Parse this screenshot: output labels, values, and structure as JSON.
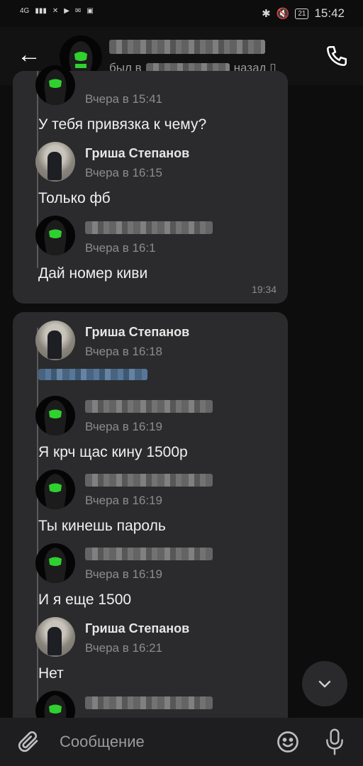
{
  "status_bar": {
    "network": "4G",
    "time": "15:42",
    "battery": "21"
  },
  "header": {
    "status_prefix": "был в",
    "status_suffix": "назад"
  },
  "messages": [
    {
      "time": "Вчера в 15:41",
      "text": "У тебя привязка к чему?"
    },
    {
      "sender": "Гриша Степанов",
      "time": "Вчера в 16:15",
      "text": "Только фб"
    },
    {
      "time": "Вчера в 16:1",
      "text": "Дай номер киви"
    },
    {
      "bubble_time": "19:34"
    },
    {
      "sender": "Гриша Степанов",
      "time": "Вчера в 16:18"
    },
    {
      "time": "Вчера в 16:19",
      "text": "Я крч щас кину 1500р"
    },
    {
      "time": "Вчера в 16:19",
      "text": "Ты кинешь пароль"
    },
    {
      "time": "Вчера в 16:19",
      "text": "И я еще 1500"
    },
    {
      "sender": "Гриша Степанов",
      "time": "Вчера в 16:21",
      "text": "Нет"
    }
  ],
  "composer": {
    "placeholder": "Сообщение"
  },
  "colors": {
    "background": "#0d0d0d",
    "bubble": "#2b2b2d",
    "accent_green": "#2fd12f"
  }
}
